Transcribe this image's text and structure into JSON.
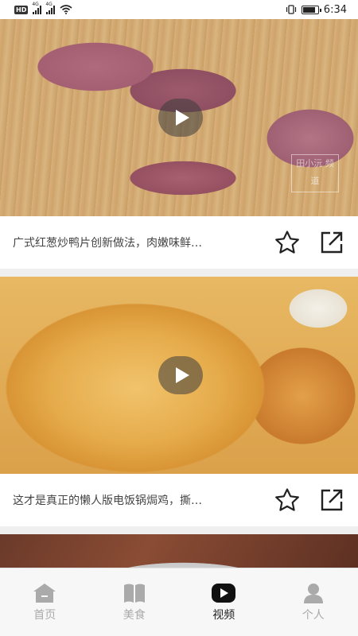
{
  "status_bar": {
    "network_badge": "HD",
    "sim1_type": "4G",
    "sim2_type": "4G",
    "time": "6:34",
    "battery_level": 0.85
  },
  "feed": {
    "items": [
      {
        "title": "广式红葱炒鸭片创新做法，肉嫩味鲜…",
        "watermark": "田小沅 频道"
      },
      {
        "title": "这才是真正的懒人版电饭锅焗鸡，撕…"
      }
    ]
  },
  "bottom_nav": {
    "items": [
      {
        "label": "首页",
        "icon": "home-icon",
        "active": false
      },
      {
        "label": "美食",
        "icon": "book-icon",
        "active": false
      },
      {
        "label": "视频",
        "icon": "video-play-icon",
        "active": true
      },
      {
        "label": "个人",
        "icon": "user-icon",
        "active": false
      }
    ]
  },
  "colors": {
    "active": "#222222",
    "inactive": "#aaaaaa",
    "background": "#efefef"
  }
}
